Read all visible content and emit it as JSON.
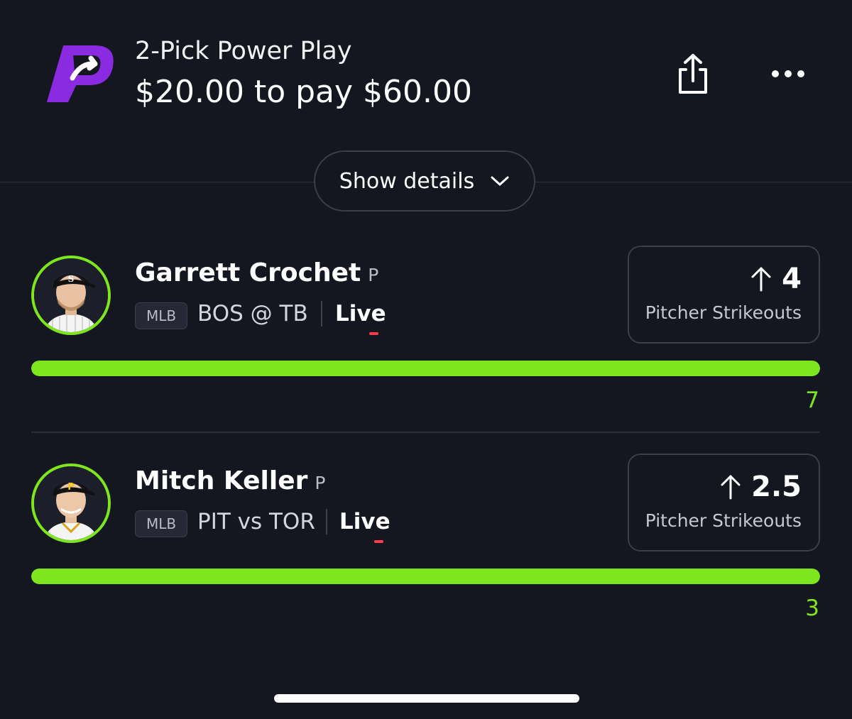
{
  "header": {
    "title": "2-Pick Power Play",
    "subtitle": "$20.00 to pay $60.00",
    "logo_icon": "prizepicks-logo-icon",
    "share_icon": "share-icon",
    "more_icon": "more-dots-icon"
  },
  "details_button": {
    "label": "Show details",
    "icon": "chevron-down-icon"
  },
  "colors": {
    "background": "#141620",
    "accent_green": "#7ee61c",
    "brand_purple": "#8a2be2",
    "live_red": "#ff3b4a",
    "border": "#3a3d4a"
  },
  "picks": [
    {
      "player_name": "Garrett Crochet",
      "position": "P",
      "league": "MLB",
      "matchup": "BOS @ TB",
      "status": "Live",
      "direction_icon": "arrow-up-icon",
      "line": "4",
      "stat": "Pitcher Strikeouts",
      "actual": "7",
      "progress_fraction": 1.0
    },
    {
      "player_name": "Mitch Keller",
      "position": "P",
      "league": "MLB",
      "matchup": "PIT vs TOR",
      "status": "Live",
      "direction_icon": "arrow-up-icon",
      "line": "2.5",
      "stat": "Pitcher Strikeouts",
      "actual": "3",
      "progress_fraction": 1.0
    }
  ]
}
